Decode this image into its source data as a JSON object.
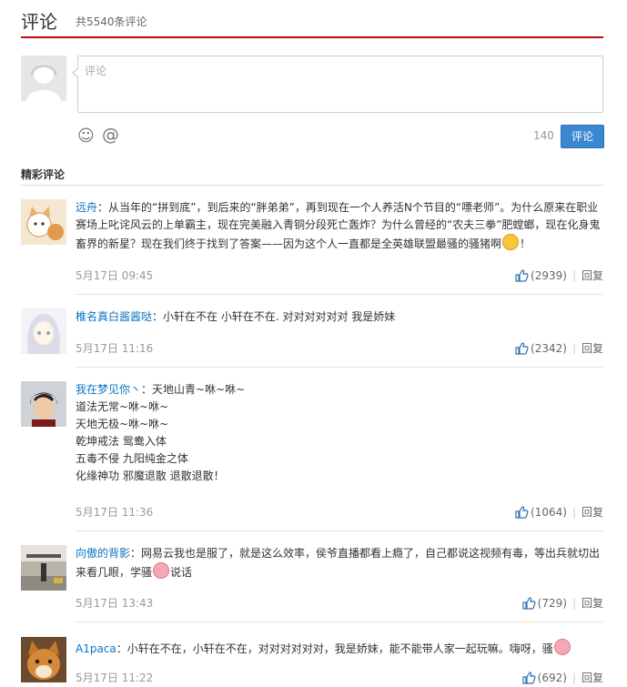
{
  "header": {
    "title": "评论",
    "count": "共5540条评论"
  },
  "editor": {
    "placeholder": "评论",
    "limit": "140",
    "send_label": "评论",
    "emoji_icon": "☺",
    "at_icon": "@"
  },
  "section": {
    "title": "精彩评论"
  },
  "reply_label": "回复",
  "colors": {
    "accent": "#c20c0c",
    "link": "#0c73c2",
    "button": "#3a88d0"
  },
  "comments": [
    {
      "user": "远舟",
      "lines": [
        "：从当年的“拼到底”，到后来的“胖弟弟”，再到现在一个人养活N个节目的“嘌老师”。为什么原来在职业赛场上叱诧风云的上单霸主，现在完美融入青铜分段死亡轰炸？为什么曾经的“农夫三拳”肥螳螂，现在化身鬼畜界的新星？现在我们终于找到了答案——因为这个人一直都是全英雄联盟最骚的骚猪啊",
        "！"
      ],
      "time": "5月17日 09:45",
      "likes": "(2939)"
    },
    {
      "user": "椎名真白酱酱哒",
      "lines": [
        "：小轩在不在 小轩在不在. 对对对对对对 我是娇妹"
      ],
      "time": "5月17日 11:16",
      "likes": "(2342)"
    },
    {
      "user": "我在梦见你丶",
      "lines": [
        "：天地山青~咻~咻~",
        "道法无常~咻~咻~",
        "天地无极~咻~咻~",
        "乾坤戒法 鸳鸯入体",
        "五毒不侵 九阳纯金之体",
        "化缘神功 邪魔退散 退散退散！"
      ],
      "time": "5月17日 11:36",
      "likes": "(1064)"
    },
    {
      "user": "向傲的背影",
      "lines": [
        "：网易云我也是服了，就是这么效率，侯爷直播都看上瘾了，自己都说这视频有毒，等出兵就切出来看几眼，学骚",
        "说话"
      ],
      "time": "5月17日 13:43",
      "likes": "(729)"
    },
    {
      "user": "A1paca",
      "lines": [
        "：小轩在不在，小轩在不在，对对对对对对，我是娇妹，能不能带人家一起玩嘛。嗨呀，骚"
      ],
      "time": "5月17日 11:22",
      "likes": "(692)"
    }
  ]
}
